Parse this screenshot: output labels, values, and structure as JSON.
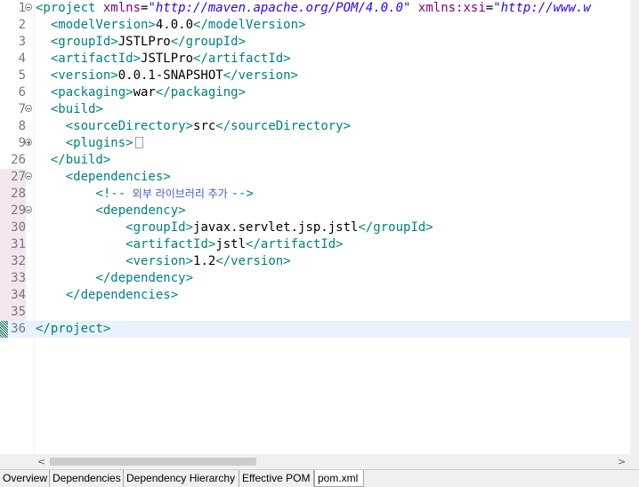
{
  "editor": {
    "lines": [
      {
        "n": "1",
        "fold": "collapse",
        "mod": false,
        "indent": "",
        "segs": [
          [
            "tag",
            "<project "
          ],
          [
            "attr",
            "xmlns"
          ],
          [
            "txt",
            "="
          ],
          [
            "str",
            "\"http://maven.apache.org/POM/4.0.0\""
          ],
          [
            "txt",
            " "
          ],
          [
            "attr",
            "xmlns:xsi"
          ],
          [
            "txt",
            "="
          ],
          [
            "str",
            "\"http://www.w"
          ]
        ]
      },
      {
        "n": "2",
        "indent": "  ",
        "segs": [
          [
            "tag",
            "<modelVersion>"
          ],
          [
            "txt",
            "4.0.0"
          ],
          [
            "tag",
            "</modelVersion>"
          ]
        ]
      },
      {
        "n": "3",
        "indent": "  ",
        "segs": [
          [
            "tag",
            "<groupId>"
          ],
          [
            "txt",
            "JSTLPro"
          ],
          [
            "tag",
            "</groupId>"
          ]
        ]
      },
      {
        "n": "4",
        "indent": "  ",
        "segs": [
          [
            "tag",
            "<artifactId>"
          ],
          [
            "txt",
            "JSTLPro"
          ],
          [
            "tag",
            "</artifactId>"
          ]
        ]
      },
      {
        "n": "5",
        "indent": "  ",
        "segs": [
          [
            "tag",
            "<version>"
          ],
          [
            "txt",
            "0.0.1-SNAPSHOT"
          ],
          [
            "tag",
            "</version>"
          ]
        ]
      },
      {
        "n": "6",
        "indent": "  ",
        "segs": [
          [
            "tag",
            "<packaging>"
          ],
          [
            "txt",
            "war"
          ],
          [
            "tag",
            "</packaging>"
          ]
        ]
      },
      {
        "n": "7",
        "fold": "collapse",
        "indent": "  ",
        "segs": [
          [
            "tag",
            "<build>"
          ]
        ]
      },
      {
        "n": "8",
        "indent": "    ",
        "segs": [
          [
            "tag",
            "<sourceDirectory>"
          ],
          [
            "txt",
            "src"
          ],
          [
            "tag",
            "</sourceDirectory>"
          ]
        ]
      },
      {
        "n": "9",
        "fold": "expand",
        "indent": "    ",
        "segs": [
          [
            "tag",
            "<plugins>"
          ]
        ],
        "collapsed": true
      },
      {
        "n": "26",
        "indent": "  ",
        "segs": [
          [
            "tag",
            "</build>"
          ]
        ]
      },
      {
        "n": "27",
        "fold": "collapse",
        "mod": true,
        "indent": "    ",
        "segs": [
          [
            "tag",
            "<dependencies>"
          ]
        ]
      },
      {
        "n": "28",
        "mod": true,
        "indent": "        ",
        "segs": [
          [
            "tag",
            "<!--"
          ],
          [
            "cmt",
            "  외부 라이브러리 추가 "
          ],
          [
            "tag",
            "-->"
          ]
        ]
      },
      {
        "n": "29",
        "fold": "collapse",
        "mod": true,
        "indent": "        ",
        "segs": [
          [
            "tag",
            "<dependency>"
          ]
        ]
      },
      {
        "n": "30",
        "mod": true,
        "indent": "            ",
        "segs": [
          [
            "tag",
            "<groupId>"
          ],
          [
            "txt",
            "javax.servlet.jsp.jstl"
          ],
          [
            "tag",
            "</groupId>"
          ]
        ]
      },
      {
        "n": "31",
        "mod": true,
        "indent": "            ",
        "segs": [
          [
            "tag",
            "<artifactId>"
          ],
          [
            "txt",
            "jstl"
          ],
          [
            "tag",
            "</artifactId>"
          ]
        ]
      },
      {
        "n": "32",
        "mod": true,
        "indent": "            ",
        "segs": [
          [
            "tag",
            "<version>"
          ],
          [
            "txt",
            "1.2"
          ],
          [
            "tag",
            "</version>"
          ]
        ]
      },
      {
        "n": "33",
        "mod": true,
        "indent": "        ",
        "segs": [
          [
            "tag",
            "</dependency>"
          ]
        ]
      },
      {
        "n": "34",
        "mod": true,
        "indent": "    ",
        "segs": [
          [
            "tag",
            "</dependencies>"
          ]
        ]
      },
      {
        "n": "35",
        "mod": true,
        "indent": "",
        "segs": []
      },
      {
        "n": "36",
        "current": true,
        "indent": "",
        "segs": [
          [
            "tag",
            "</project>"
          ]
        ]
      }
    ]
  },
  "scrollbar": {
    "left_arrow": "<",
    "right_arrow": ">"
  },
  "tabs": [
    {
      "label": "Overview",
      "active": false
    },
    {
      "label": "Dependencies",
      "active": false
    },
    {
      "label": "Dependency Hierarchy",
      "active": false
    },
    {
      "label": "Effective POM",
      "active": false
    },
    {
      "label": "pom.xml",
      "active": true
    }
  ],
  "colors": {
    "tag": "#008080",
    "attribute": "#7f007f",
    "string": "#2a00ff",
    "comment": "#3f5fbf",
    "current_line": "#e8f2fe"
  }
}
